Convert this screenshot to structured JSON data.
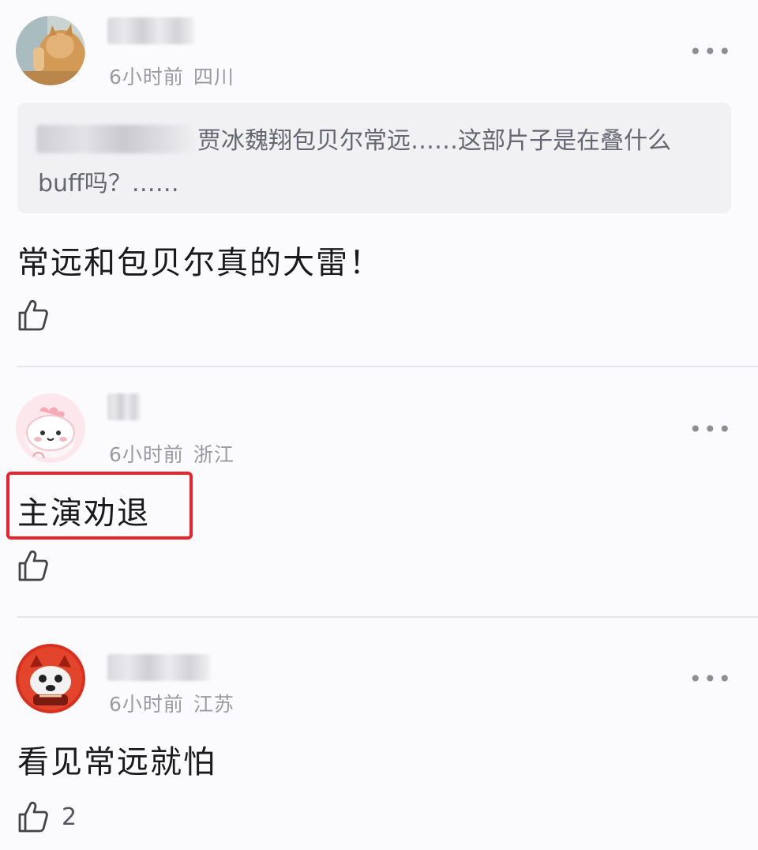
{
  "comments": [
    {
      "time": "6小时前",
      "location": "四川",
      "quote_text": "贾冰魏翔包贝尔常远……这部片子是在叠什么buff吗？……",
      "text": "常远和包贝尔真的大雷！",
      "likes": ""
    },
    {
      "time": "6小时前",
      "location": "浙江",
      "text": "主演劝退",
      "likes": ""
    },
    {
      "time": "6小时前",
      "location": "江苏",
      "text": "看见常远就怕",
      "likes": "2"
    }
  ],
  "more_glyph": "•••",
  "highlight_color": "#e8232d",
  "icons": {
    "like": "thumbs-up-icon",
    "more": "more-dots-icon"
  }
}
